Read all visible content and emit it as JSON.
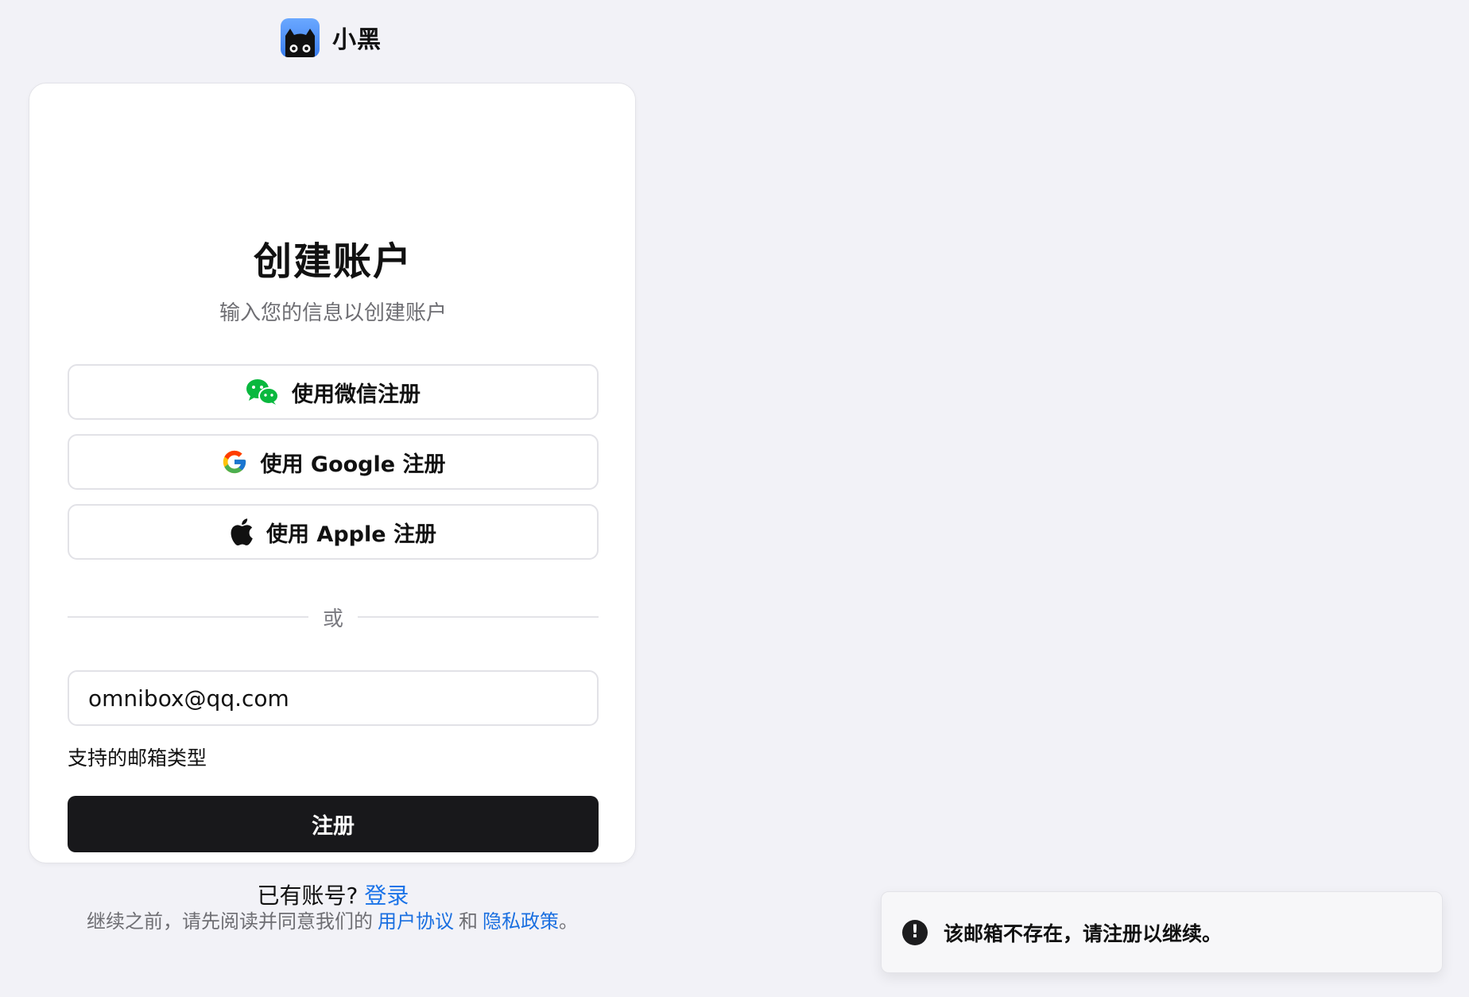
{
  "brand": {
    "name": "小黑",
    "logo_icon": "black-cat-icon"
  },
  "signup": {
    "title": "创建账户",
    "subtitle": "输入您的信息以创建账户",
    "oauth": {
      "wechat_label": "使用微信注册",
      "google_label": "使用 Google 注册",
      "apple_label": "使用 Apple 注册"
    },
    "divider_label": "或",
    "email": {
      "value": "omnibox@qq.com",
      "placeholder": ""
    },
    "supported_types_label": "支持的邮箱类型",
    "submit_label": "注册",
    "login_prompt": "已有账号?",
    "login_link": "登录"
  },
  "terms": {
    "prefix": "继续之前，请先阅读并同意我们的",
    "user_agreement": "用户协议",
    "and": "和",
    "privacy_policy": "隐私政策",
    "suffix": "。"
  },
  "toast": {
    "icon": "exclamation-circle-icon",
    "message": "该邮箱不存在，请注册以继续。"
  },
  "colors": {
    "background": "#f2f2f7",
    "primary_button": "#18181b",
    "link": "#1a73e8",
    "wechat_green": "#09b83e"
  }
}
